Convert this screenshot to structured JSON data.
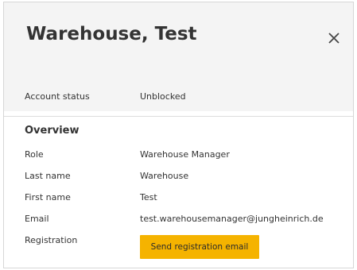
{
  "dialog": {
    "title": "Warehouse, Test",
    "close_icon": "close-icon"
  },
  "account_status": {
    "label": "Account status",
    "value": "Unblocked"
  },
  "overview": {
    "title": "Overview",
    "fields": [
      {
        "label": "Role",
        "value": "Warehouse Manager"
      },
      {
        "label": "Last name",
        "value": "Warehouse"
      },
      {
        "label": "First name",
        "value": "Test"
      },
      {
        "label": "Email",
        "value": "test.warehousemanager@jungheinrich.de"
      }
    ],
    "registration": {
      "label": "Registration",
      "button_label": "Send registration email"
    }
  },
  "colors": {
    "header_bg": "#f4f4f4",
    "button_bg": "#f5b300",
    "text": "#333333"
  }
}
